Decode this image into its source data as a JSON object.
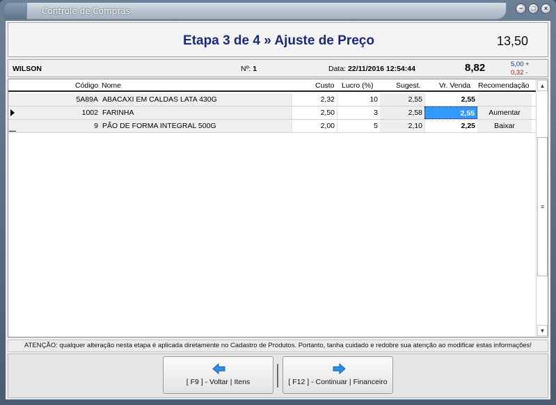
{
  "window": {
    "title": "Controle de Compras",
    "controls": {
      "minimize": "−",
      "maximize": "□",
      "close": "×"
    }
  },
  "header": {
    "step_title": "Etapa 3 de 4 » Ajuste de Preço",
    "total": "13,50"
  },
  "info": {
    "supplier": "WILSON",
    "number_label": "Nº:",
    "number_value": "1",
    "date_label": "Data:",
    "date_value": "22/11/2016 12:54:44",
    "big_value": "8,82",
    "plus_value": "5,00 +",
    "minus_value": "0,32 -"
  },
  "grid": {
    "columns": {
      "codigo": "Código",
      "nome": "Nome",
      "custo": "Custo",
      "lucro": "Lucro (%)",
      "sugest": "Sugest.",
      "venda": "Vr. Venda",
      "recomendacao": "Recomendação"
    },
    "rows": [
      {
        "codigo": "5A89A",
        "nome": "ABACAXI EM CALDAS LATA 430G",
        "custo": "2,32",
        "lucro": "10",
        "sugest": "2,55",
        "venda": "2,55",
        "recomendacao": ""
      },
      {
        "codigo": "1002",
        "nome": "FARINHA",
        "custo": "2,50",
        "lucro": "3",
        "sugest": "2,58",
        "venda": "2,55",
        "recomendacao": "Aumentar"
      },
      {
        "codigo": "9",
        "nome": "PÃO DE FORMA INTEGRAL 500G",
        "custo": "2,00",
        "lucro": "5",
        "sugest": "2,10",
        "venda": "2,25",
        "recomendacao": "Baixar"
      }
    ],
    "scroll_up": "▲",
    "scroll_down": "▼",
    "scroll_grip": "≡"
  },
  "warning": "ATENÇÃO: qualquer alteração nesta etapa é aplicada diretamente no Cadastro de Produtos. Portanto, tanha cuidado e redobre sua atenção ao modificar estas informações!",
  "footer": {
    "back_label": "[ F9 ] - Voltar | Itens",
    "next_label": "[ F12 ] - Continuar | Financeiro"
  },
  "colors": {
    "title_blue": "#1c2a7a",
    "selection": "#3399ff",
    "arrow_blue": "#2f8fe8"
  }
}
